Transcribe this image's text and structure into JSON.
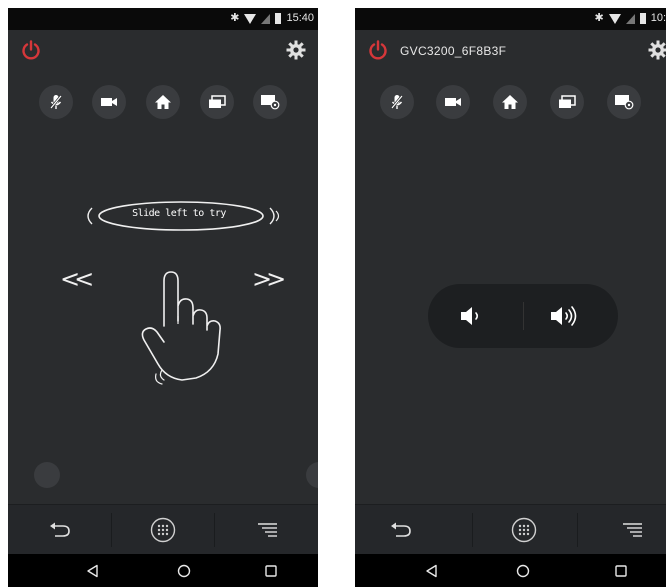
{
  "left_screen": {
    "status_bar": {
      "time": "15:40"
    },
    "quick_actions": [
      {
        "icon": "mic-muted-icon"
      },
      {
        "icon": "video-camera-icon"
      },
      {
        "icon": "home-icon"
      },
      {
        "icon": "window-icon"
      },
      {
        "icon": "presentation-icon"
      }
    ],
    "tutorial": {
      "hint_text": "Slide left to try",
      "left_arrow": "<<",
      "right_arrow": ">>"
    }
  },
  "right_screen": {
    "status_bar": {
      "time": "10:"
    },
    "device_name": "GVC3200_6F8B3F",
    "quick_actions": [
      {
        "icon": "mic-muted-icon"
      },
      {
        "icon": "video-camera-icon"
      },
      {
        "icon": "home-icon"
      },
      {
        "icon": "window-icon"
      },
      {
        "icon": "presentation-icon"
      }
    ],
    "volume": {
      "down_icon": "volume-down-icon",
      "up_icon": "volume-up-icon"
    }
  },
  "bottom_bar": {
    "icons": [
      "back-arrow-icon",
      "keypad-icon",
      "menu-icon"
    ]
  },
  "nav_bar": {
    "icons": [
      "nav-back-icon",
      "nav-home-icon",
      "nav-recents-icon"
    ]
  },
  "colors": {
    "screen_bg": "#2a2c2e",
    "power_red": "#d6373a",
    "icon_white": "#ffffff",
    "button_bg": "#3a3c3f",
    "pill_bg": "#1d1f21"
  }
}
